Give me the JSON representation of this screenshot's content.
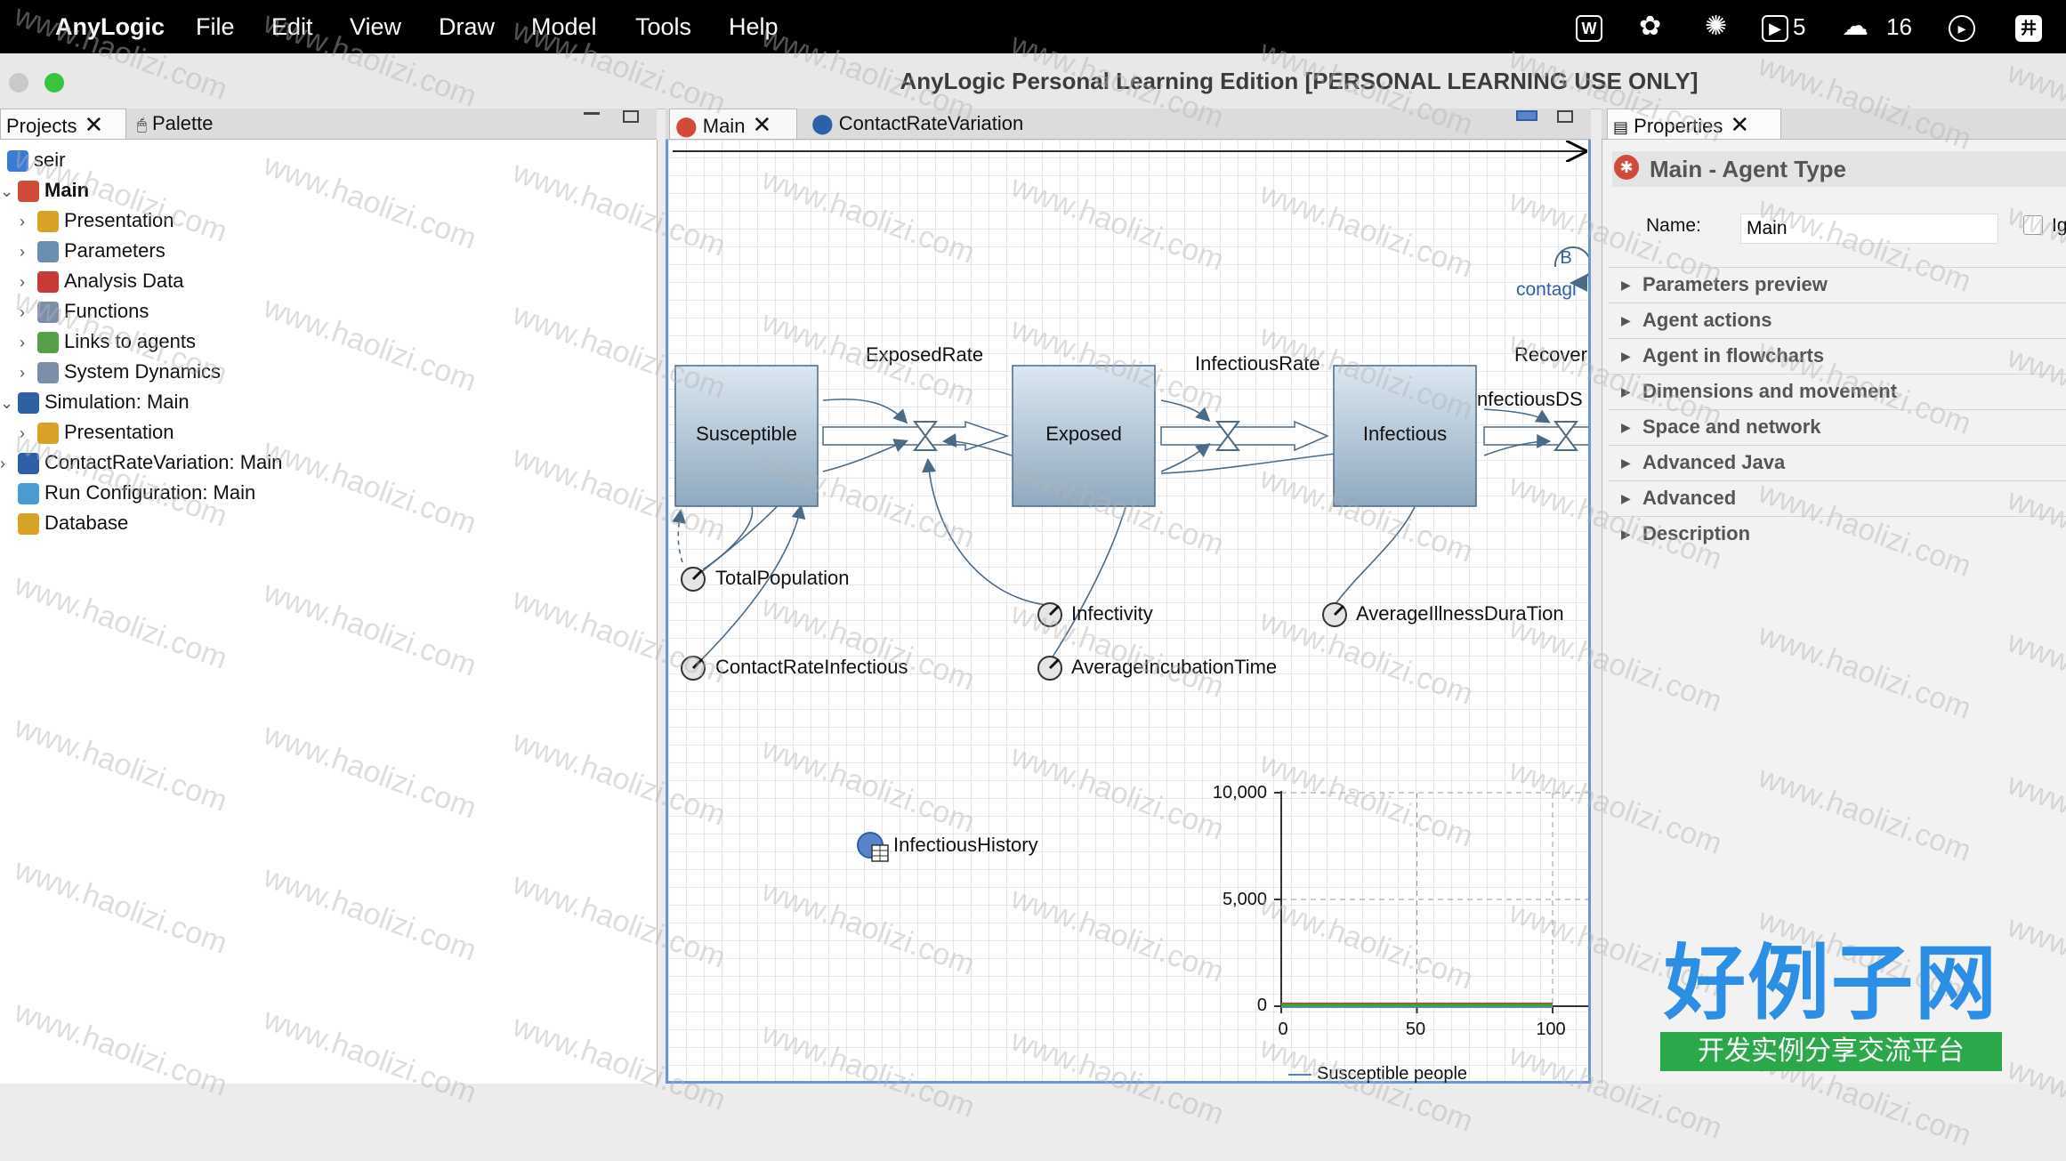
{
  "menubar": {
    "app_name": "AnyLogic",
    "items": [
      "File",
      "Edit",
      "View",
      "Draw",
      "Model",
      "Tools",
      "Help"
    ],
    "status": {
      "badge1": "5",
      "badge2": "16",
      "hash": "井"
    }
  },
  "window": {
    "title": "AnyLogic Personal Learning Edition [PERSONAL LEARNING USE ONLY]"
  },
  "left_panel": {
    "tabs": [
      "Projects",
      "Palette"
    ],
    "tree": [
      {
        "label": "seir",
        "indent": 0,
        "chevron": ""
      },
      {
        "label": "Main",
        "indent": 0,
        "chevron": "v",
        "bold": true
      },
      {
        "label": "Presentation",
        "indent": 1,
        "chevron": ">"
      },
      {
        "label": "Parameters",
        "indent": 1,
        "chevron": ">"
      },
      {
        "label": "Analysis Data",
        "indent": 1,
        "chevron": ">"
      },
      {
        "label": "Functions",
        "indent": 1,
        "chevron": ">"
      },
      {
        "label": "Links to agents",
        "indent": 1,
        "chevron": ">"
      },
      {
        "label": "System Dynamics",
        "indent": 1,
        "chevron": ">"
      },
      {
        "label": "Simulation: Main",
        "indent": 0,
        "chevron": "v"
      },
      {
        "label": "Presentation",
        "indent": 1,
        "chevron": ">"
      },
      {
        "label": "ContactRateVariation: Main",
        "indent": 0,
        "chevron": ">"
      },
      {
        "label": "Run Configuration: Main",
        "indent": 0,
        "chevron": ""
      },
      {
        "label": "Database",
        "indent": 0,
        "chevron": ""
      }
    ]
  },
  "editor": {
    "tabs": [
      "Main",
      "ContactRateVariation"
    ],
    "stocks": [
      "Susceptible",
      "Exposed",
      "Infectious"
    ],
    "flows": [
      "ExposedRate",
      "InfectiousRate",
      "Recover"
    ],
    "flow_partial": "nfectiousDS",
    "parameters": [
      "TotalPopulation",
      "ContactRateInfectious",
      "Infectivity",
      "AverageIncubationTime",
      "AverageIllnessDuraTion"
    ],
    "loop_label": "B",
    "loop_text": "contagi",
    "dataset": "InfectiousHistory",
    "chart": {
      "y_ticks": [
        "10,000",
        "5,000",
        "0"
      ],
      "x_ticks": [
        "0",
        "50",
        "100"
      ],
      "legend": "Susceptible people"
    }
  },
  "properties": {
    "tab": "Properties",
    "heading": "Main - Agent Type",
    "name_label": "Name:",
    "name_value": "Main",
    "ignore_label": "Ig",
    "sections": [
      "Parameters preview",
      "Agent actions",
      "Agent in flowcharts",
      "Dimensions and movement",
      "Space and network",
      "Advanced Java",
      "Advanced",
      "Description"
    ]
  },
  "watermark": {
    "text": "www.haolizi.com",
    "logo_main": "好例子网",
    "logo_sub": "开发实例分享交流平台"
  },
  "chart_data": {
    "type": "line",
    "x": [
      0,
      100
    ],
    "series": [
      {
        "name": "Susceptible people",
        "values": [
          0,
          0
        ]
      }
    ],
    "ylim": [
      0,
      10000
    ],
    "xlim": [
      0,
      100
    ]
  }
}
